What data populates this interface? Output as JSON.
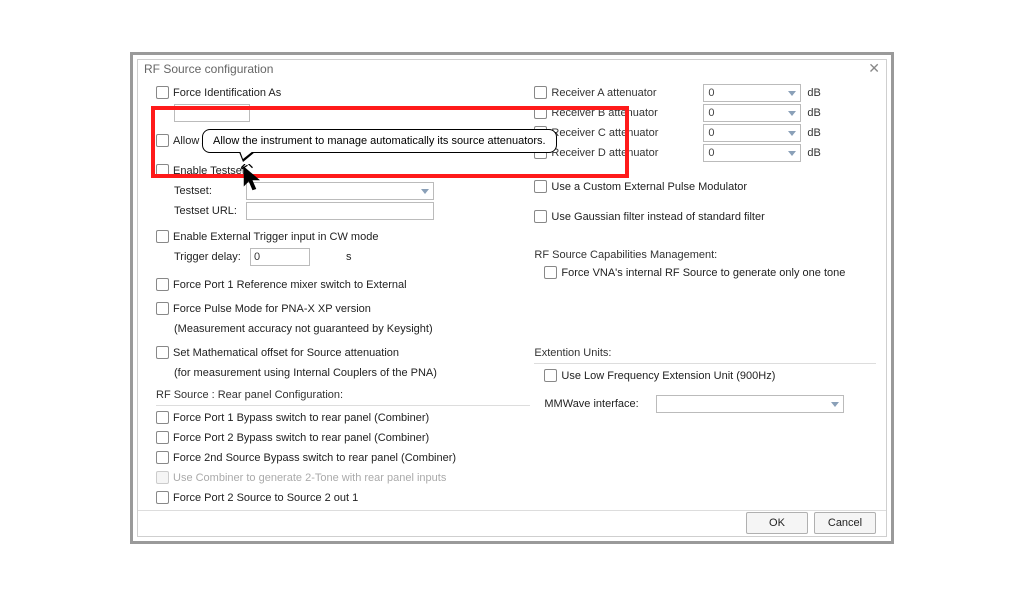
{
  "window": {
    "title": "RF Source configuration"
  },
  "tooltip": {
    "text": "Allow the instrument to manage automatically its source attenuators."
  },
  "left": {
    "force_id": "Force Identification As",
    "force_id_value": "",
    "allow_autorange": "Allow AutoRange",
    "enable_testset": "Enable Testset",
    "testset_label": "Testset:",
    "testset_value": "",
    "testset_url_label": "Testset URL:",
    "testset_url_value": "",
    "enable_ext_trigger": "Enable External Trigger input in CW mode",
    "trigger_delay_label": "Trigger delay:",
    "trigger_delay_value": "0",
    "trigger_delay_unit": "s",
    "force_port1_ref": "Force Port 1 Reference mixer switch to External",
    "force_pulse_mode": "Force Pulse Mode for PNA-X XP version",
    "force_pulse_note": "(Measurement accuracy not guaranteed by Keysight)",
    "set_math_offset": "Set Mathematical offset for Source attenuation",
    "set_math_note": "(for measurement using Internal Couplers of the PNA)",
    "rear_panel_title": "RF Source : Rear panel Configuration:",
    "rp_opt1": "Force Port 1 Bypass switch to rear panel (Combiner)",
    "rp_opt2": "Force Port 2 Bypass switch to rear panel (Combiner)",
    "rp_opt3": "Force 2nd Source Bypass switch to rear panel (Combiner)",
    "rp_opt4": "Use Combiner to generate 2-Tone with rear panel inputs",
    "rp_opt5": "Force Port 2 Source to Source 2 out 1"
  },
  "right": {
    "attn": [
      {
        "label": "Receiver A attenuator",
        "value": "0",
        "unit": "dB"
      },
      {
        "label": "Receiver B attenuator",
        "value": "0",
        "unit": "dB"
      },
      {
        "label": "Receiver C attenuator",
        "value": "0",
        "unit": "dB"
      },
      {
        "label": "Receiver D attenuator",
        "value": "0",
        "unit": "dB"
      }
    ],
    "use_custom_pulse": "Use a Custom External Pulse Modulator",
    "use_gaussian": "Use Gaussian filter instead of standard filter",
    "caps_title": "RF Source Capabilities Management:",
    "caps_opt": "Force VNA's internal RF Source to generate only one tone",
    "ext_title": "Extention Units:",
    "ext_low_freq": "Use Low Frequency Extension Unit (900Hz)",
    "mmw_label": "MMWave interface:",
    "mmw_value": ""
  },
  "footer": {
    "ok": "OK",
    "cancel": "Cancel"
  }
}
